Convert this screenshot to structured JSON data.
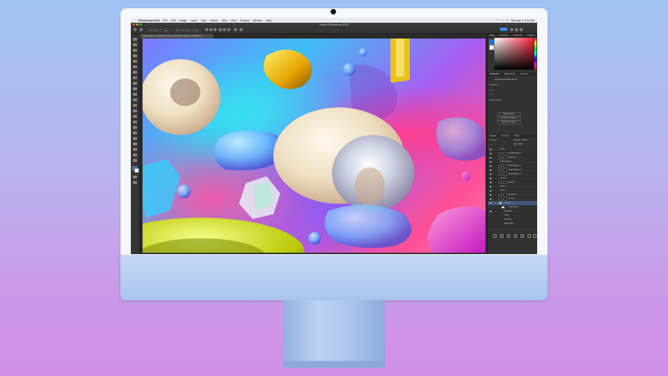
{
  "menubar": {
    "app": "Photoshop 2024",
    "items": [
      "File",
      "Edit",
      "Image",
      "Layer",
      "Type",
      "Select",
      "Filter",
      "View",
      "Plugins",
      "Window",
      "Help"
    ],
    "clock": "Mon Apr 1  9:41 AM"
  },
  "window": {
    "title": "Adobe Photoshop 2024"
  },
  "options_bar": {
    "auto_select": "Auto-Select:",
    "layer_value": "Layer",
    "show_transform": "Show Transform Controls",
    "share_label": "Share"
  },
  "document": {
    "tab": "Apple Deliro Composition Test 4.psd @ 40% (Layer 5, RGB/8*) ×"
  },
  "status": {
    "text": "40%   2560 px x 1440 px (72 ppi)"
  },
  "panels": {
    "color_tabs": [
      "Color",
      "Swatches",
      "Gradients",
      "Patterns"
    ],
    "properties_tabs": [
      "Properties",
      "Adjustments",
      "Libraries"
    ],
    "properties_kind": "Embedded Smart Object",
    "transform_label": "Transform",
    "layer_comp_label": "Layer Comp",
    "buttons": [
      "Edit Contents",
      "Convert to Linked...",
      "Convert to Layers"
    ],
    "layers_tabs": [
      "Layers",
      "Channels",
      "Paths"
    ],
    "blend_mode": "Normal",
    "opacity": "Opacity: 100%",
    "fill": "Fill: 100%",
    "layers": [
      {
        "name": "Group"
      },
      {
        "name": "Hue/Saturation 1"
      },
      {
        "name": "Vibrance 1"
      },
      {
        "name": "Glass Shapes"
      },
      {
        "name": "Color Balance 4"
      },
      {
        "name": "Color Balance 3"
      },
      {
        "name": "Color Balance 2"
      },
      {
        "name": "Group 2"
      },
      {
        "name": "Levels 2"
      },
      {
        "name": "Shell 2"
      },
      {
        "name": "Shell 1"
      },
      {
        "name": "Exposure 1"
      },
      {
        "name": "Levels 1"
      },
      {
        "name": "Layer 5"
      },
      {
        "name": "Smart Filters"
      },
      {
        "name": "Add Noise"
      },
      {
        "name": "Clarity"
      },
      {
        "name": "Field Blur"
      },
      {
        "name": "Surface Blur"
      }
    ]
  },
  "colors": {
    "accent": "#1473e6",
    "panel_bg": "#323232",
    "imac_blue": "#a9c4ec"
  }
}
